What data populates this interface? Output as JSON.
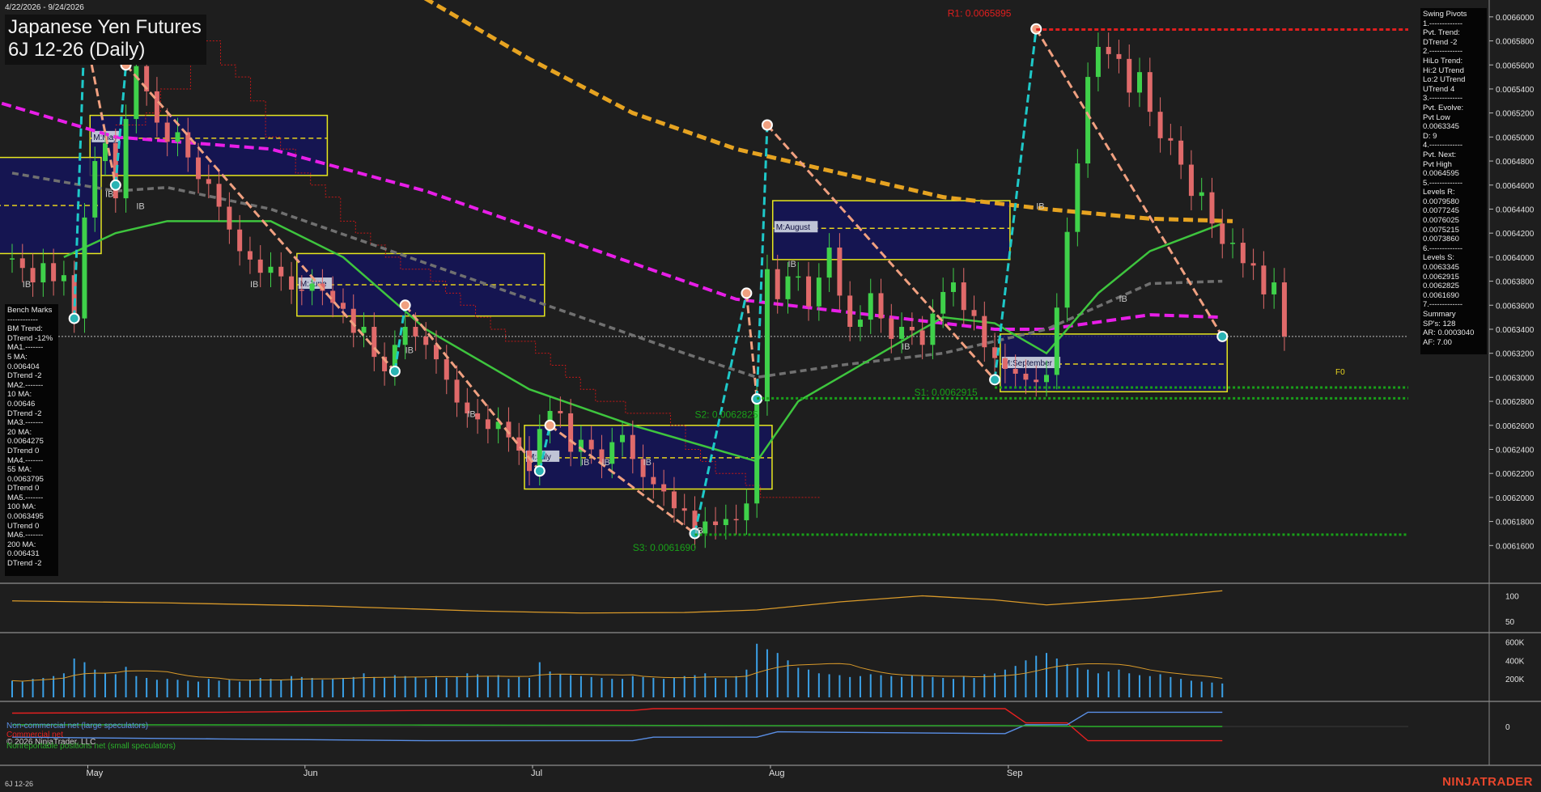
{
  "header": {
    "date_range": "4/22/2026 - 9/24/2026",
    "title_line1": "Japanese Yen Futures",
    "title_line2": "6J 12-26 (Daily)"
  },
  "footer": {
    "symbol": "6J 12-26",
    "brand": "NINJATRADER",
    "copyright": "© 2026 NinjaTrader, LLC"
  },
  "colors": {
    "background": "#1e1e1e",
    "up_candle": "#3fd14a",
    "down_candle": "#e06a6a",
    "ma_green": "#3ec53e",
    "ma_magenta": "#e81ee8",
    "ma_gold": "#e6a321",
    "ma_gray": "#707070",
    "swing_teal": "#1ec8c8",
    "swing_salmon": "#f0a080",
    "monthly_box_fill": "#14145a",
    "monthly_box_border": "#e6e61e",
    "resistance_red": "#e01e1e",
    "support_green": "#19a019",
    "cot_noncommercial": "#5a8fe6",
    "cot_commercial": "#e62020",
    "cot_small": "#2ab02a"
  },
  "bench_marks": [
    "Bench Marks",
    "------------",
    "BM Trend:",
    "DTrend -12%",
    "MA1.-------",
    "5 MA:",
    "0.006404",
    "DTrend -2",
    "MA2.-------",
    "10 MA:",
    "0.00646",
    "DTrend -2",
    "MA3.-------",
    "20 MA:",
    "0.0064275",
    "DTrend 0",
    "MA4.-------",
    "55 MA:",
    "0.0063795",
    "DTrend 0",
    "MA5.-------",
    "100 MA:",
    "0.0063495",
    "UTrend 0",
    "MA6.-------",
    "200 MA:",
    "0.006431",
    "DTrend -2"
  ],
  "swing_pivots": [
    "Swing Pivots",
    "1.-------------",
    "Pvt. Trend:",
    "DTrend -2",
    "2.-------------",
    "HiLo Trend:",
    "Hi:2 UTrend",
    "Lo:2 UTrend",
    "UTrend 4",
    "3.-------------",
    "Pvt. Evolve:",
    "Pvt Low",
    "0.0063345",
    "D: 9",
    "4.-------------",
    "Pvt. Next:",
    "Pvt High",
    "0.0064595",
    "5.-------------",
    "Levels R:",
    "0.0079580",
    "0.0077245",
    "0.0076025",
    "0.0075215",
    "0.0073860",
    "6.-------------",
    "Levels S:",
    "0.0063345",
    "0.0062915",
    "0.0062825",
    "0.0061690",
    "7.-------------",
    "Summary",
    "SP's: 128",
    "AR: 0.0003040",
    "AF: 7.00"
  ],
  "cot_legend": {
    "noncommercial": "Non-commercial net (large speculators)",
    "commercial": "Commercial net",
    "small": "Nonreportable positions net (small speculators)"
  },
  "chart_data": {
    "type": "candlestick",
    "x_ticks": [
      "May",
      "Jun",
      "Jul",
      "Aug",
      "Sep"
    ],
    "y_ticks": [
      "0.0066000",
      "0.0065800",
      "0.0065600",
      "0.0065400",
      "0.0065200",
      "0.0065000",
      "0.0064800",
      "0.0064600",
      "0.0064400",
      "0.0064200",
      "0.0064000",
      "0.0063800",
      "0.0063600",
      "0.0063400",
      "0.0063200",
      "0.0063000",
      "0.0062800",
      "0.0062600",
      "0.0062400",
      "0.0062200",
      "0.0062000",
      "0.0061800",
      "0.0061600"
    ],
    "ylim": [
      0.00614,
      0.00661
    ],
    "grid": false,
    "closes": [
      0.006399,
      0.006391,
      0.006379,
      0.006395,
      0.00638,
      0.006385,
      0.006349,
      0.006433,
      0.00648,
      0.006495,
      0.006449,
      0.006515,
      0.006559,
      0.006538,
      0.006512,
      0.006496,
      0.006504,
      0.006483,
      0.006465,
      0.006461,
      0.006442,
      0.006423,
      0.006405,
      0.006398,
      0.006387,
      0.006392,
      0.006384,
      0.006373,
      0.006372,
      0.006378,
      0.006372,
      0.006362,
      0.006357,
      0.006337,
      0.006342,
      0.006317,
      0.006305,
      0.006327,
      0.006342,
      0.006334,
      0.006327,
      0.006315,
      0.006298,
      0.006279,
      0.00627,
      0.006265,
      0.006257,
      0.006263,
      0.00625,
      0.006239,
      0.006222,
      0.006257,
      0.006272,
      0.00627,
      0.006238,
      0.006248,
      0.00624,
      0.006228,
      0.006246,
      0.006252,
      0.006232,
      0.006217,
      0.006211,
      0.006205,
      0.006191,
      0.006189,
      0.00617,
      0.00618,
      0.006177,
      0.006182,
      0.006181,
      0.006195,
      0.00628,
      0.00639,
      0.006365,
      0.006384,
      0.006384,
      0.006359,
      0.006383,
      0.006408,
      0.006368,
      0.006342,
      0.006348,
      0.00637,
      0.006349,
      0.006332,
      0.006342,
      0.006339,
      0.006327,
      0.006353,
      0.006371,
      0.006379,
      0.006356,
      0.006351,
      0.006325,
      0.006316,
      0.006307,
      0.006303,
      0.006298,
      0.006296,
      0.006302,
      0.006358,
      0.006421,
      0.006478,
      0.00655,
      0.006575,
      0.006569,
      0.006565,
      0.006537,
      0.006554,
      0.006521,
      0.006499,
      0.006497,
      0.006477,
      0.006451,
      0.006454,
      0.006428,
      0.006411,
      0.006412,
      0.006395,
      0.006393,
      0.006369,
      0.006379,
      0.006334
    ],
    "closes_direction": "oldest-to-newest",
    "oscillator_ticks": [
      "100",
      "50"
    ],
    "volume_ticks": [
      "600K",
      "400K",
      "200K"
    ],
    "cot_ticks": [
      "0"
    ],
    "levels": {
      "R1": {
        "label": "R1: 0.0065895",
        "value": 0.0065895
      },
      "S1": {
        "label": "S1: 0.0062915",
        "value": 0.0062915
      },
      "S2": {
        "label": "S2: 0.0062825",
        "value": 0.0062825
      },
      "S3": {
        "label": "S3: 0.0061690",
        "value": 0.006169
      }
    },
    "monthly_boxes": [
      {
        "label": "M:May",
        "start": 8,
        "end": 30,
        "high": 0.006518,
        "low": 0.006468,
        "mid": 0.006499
      },
      {
        "label": "M:June",
        "start": 28,
        "end": 51,
        "high": 0.006403,
        "low": 0.006351,
        "mid": 0.006377
      },
      {
        "label": "M:July",
        "start": 50,
        "end": 73,
        "high": 0.00626,
        "low": 0.006207,
        "mid": 0.006233
      },
      {
        "label": "M:August",
        "start": 74,
        "end": 96,
        "high": 0.006447,
        "low": 0.006398,
        "mid": 0.006424
      },
      {
        "label": "M:September",
        "start": 96,
        "end": 117,
        "high": 0.006336,
        "low": 0.006288,
        "mid": 0.006311
      }
    ],
    "month_markers": [
      "F0"
    ],
    "ib_labels": [
      "IB"
    ]
  }
}
